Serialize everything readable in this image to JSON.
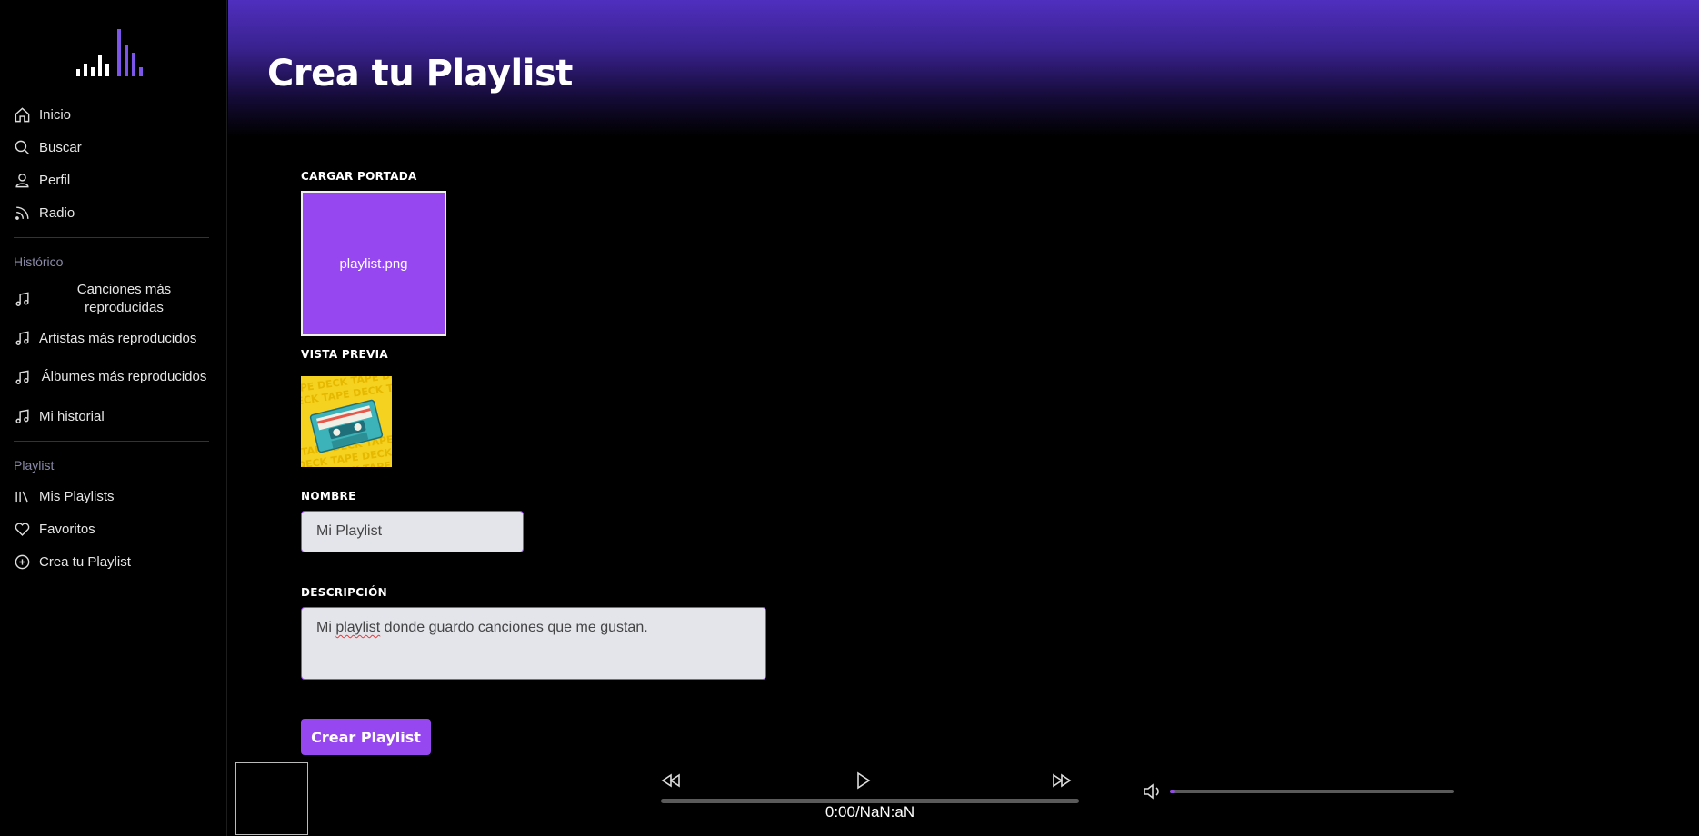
{
  "nav": {
    "main": [
      {
        "label": "Inicio",
        "icon": "home-icon"
      },
      {
        "label": "Buscar",
        "icon": "search-icon"
      },
      {
        "label": "Perfil",
        "icon": "user-icon"
      },
      {
        "label": "Radio",
        "icon": "rss-icon"
      }
    ],
    "history_title": "Histórico",
    "history": [
      {
        "label": "Canciones más reproducidas",
        "icon": "music-note-icon"
      },
      {
        "label": "Artistas más reproducidos",
        "icon": "music-note-icon"
      },
      {
        "label": "Álbumes más reproducidos",
        "icon": "music-note-icon"
      },
      {
        "label": "Mi historial",
        "icon": "music-note-icon"
      }
    ],
    "playlist_title": "Playlist",
    "playlist": [
      {
        "label": "Mis Playlists",
        "icon": "library-icon"
      },
      {
        "label": "Favoritos",
        "icon": "heart-icon"
      },
      {
        "label": "Crea tu Playlist",
        "icon": "plus-circle-icon"
      }
    ]
  },
  "page": {
    "title": "Crea tu Playlist"
  },
  "form": {
    "cover_label": "CARGAR PORTADA",
    "cover_file": "playlist.png",
    "preview_label": "VISTA PREVIA",
    "name_label": "NOMBRE",
    "name_value": "Mi Playlist",
    "desc_label": "DESCRIPCIÓN",
    "desc_before": "Mi ",
    "desc_misspelled": "playlist",
    "desc_after": " donde guardo canciones que me gustan.",
    "submit_label": "Crear Playlist"
  },
  "player": {
    "time": "0:00/NaN:aN",
    "progress": 0,
    "volume": 0.02
  },
  "colors": {
    "accent": "#9747f0",
    "header_top": "#4f2fbe"
  }
}
